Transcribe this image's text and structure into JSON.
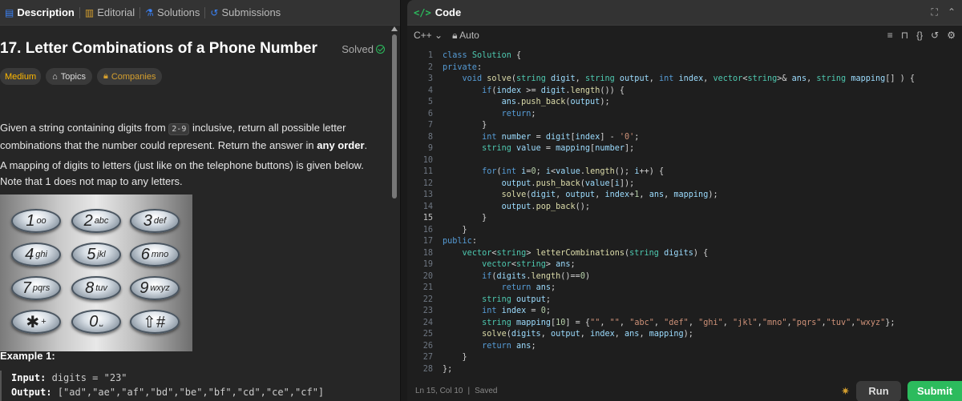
{
  "left": {
    "tabs": [
      {
        "label": "Description",
        "icon": "description-icon",
        "active": true
      },
      {
        "label": "Editorial",
        "icon": "book-icon",
        "active": false
      },
      {
        "label": "Solutions",
        "icon": "flask-icon",
        "active": false
      },
      {
        "label": "Submissions",
        "icon": "history-icon",
        "active": false
      }
    ],
    "title": "17. Letter Combinations of a Phone Number",
    "solved": "Solved",
    "badges": {
      "difficulty": "Medium",
      "topics": "Topics",
      "companies": "Companies"
    },
    "p1": {
      "a": "Given a string containing digits from ",
      "code": "2-9",
      "b": " inclusive, return all possible letter combinations that the number could represent. Return the answer in ",
      "bold": "any order",
      "c": "."
    },
    "p2": "A mapping of digits to letters (just like on the telephone buttons) is given below. Note that 1 does not map to any letters.",
    "keypad": [
      {
        "num": "1",
        "letters": "ᴏᴏ"
      },
      {
        "num": "2",
        "letters": "abc"
      },
      {
        "num": "3",
        "letters": "def"
      },
      {
        "num": "4",
        "letters": "ghi"
      },
      {
        "num": "5",
        "letters": "jkl"
      },
      {
        "num": "6",
        "letters": "mno"
      },
      {
        "num": "7",
        "letters": "pqrs"
      },
      {
        "num": "8",
        "letters": "tuv"
      },
      {
        "num": "9",
        "letters": "wxyz"
      },
      {
        "num": "✱",
        "letters": "+"
      },
      {
        "num": "0",
        "letters": "⎵"
      },
      {
        "num": "⇧#",
        "letters": ""
      }
    ],
    "example": {
      "title": "Example 1:",
      "input_label": "Input:",
      "input_value": "digits = \"23\"",
      "output_label": "Output:",
      "output_value": "[\"ad\",\"ae\",\"af\",\"bd\",\"be\",\"bf\",\"cd\",\"ce\",\"cf\"]"
    }
  },
  "right": {
    "title": "Code",
    "language": "C++",
    "mode": "Auto",
    "status": {
      "position": "Ln 15, Col 10",
      "saved": "Saved"
    },
    "buttons": {
      "run": "Run",
      "submit": "Submit"
    },
    "current_line": 15,
    "code_lines": [
      "class Solution {",
      "private:",
      "    void solve(string digit, string output, int index, vector<string>& ans, string mapping[] ) {",
      "        if(index >= digit.length()) {",
      "            ans.push_back(output);",
      "            return;",
      "        }",
      "        int number = digit[index] - '0';",
      "        string value = mapping[number];",
      "",
      "        for(int i=0; i<value.length(); i++) {",
      "            output.push_back(value[i]);",
      "            solve(digit, output, index+1, ans, mapping);",
      "            output.pop_back();",
      "        }",
      "    }",
      "public:",
      "    vector<string> letterCombinations(string digits) {",
      "        vector<string> ans;",
      "        if(digits.length()==0)",
      "            return ans;",
      "        string output;",
      "        int index = 0;",
      "        string mapping[10] = {\"\", \"\", \"abc\", \"def\", \"ghi\", \"jkl\",\"mno\",\"pqrs\",\"tuv\",\"wxyz\"};",
      "        solve(digits, output, index, ans, mapping);",
      "        return ans;",
      "    }",
      "};"
    ]
  }
}
